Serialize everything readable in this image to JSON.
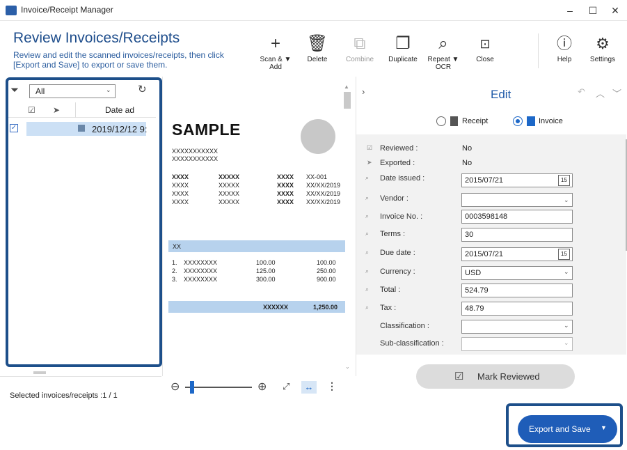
{
  "window": {
    "title": "Invoice/Receipt Manager",
    "minimize": "–",
    "maximize": "☐",
    "close": "✕"
  },
  "header": {
    "title": "Review Invoices/Receipts",
    "description": "Review and edit the scanned invoices/receipts, then click [Export and Save] to export or save them."
  },
  "toolbar": {
    "scan_add": "Scan & Add",
    "scan_add_l1": "Scan & ▼",
    "scan_add_l2": "Add",
    "delete": "Delete",
    "combine": "Combine",
    "duplicate": "Duplicate",
    "repeat_ocr_l1": "Repeat ▼",
    "repeat_ocr_l2": "OCR",
    "close": "Close",
    "help": "Help",
    "settings": "Settings"
  },
  "list": {
    "filter_value": "All",
    "column_date": "Date ad",
    "rows": [
      {
        "checked": true,
        "date": "2019/12/12 9:"
      }
    ],
    "status": "Selected invoices/receipts :1 / 1"
  },
  "preview": {
    "sample": "SAMPLE",
    "lines_top": [
      "XXXXXXXXXXX",
      "XXXXXXXXXXX"
    ],
    "grid_rows": [
      [
        "XXXX",
        "XXXXX",
        "XXXX",
        "XX-001"
      ],
      [
        "XXXX",
        "XXXXX",
        "XXXX",
        "XX/XX/2019"
      ],
      [
        "XXXX",
        "XXXXX",
        "XXXX",
        "XX/XX/2019"
      ],
      [
        "XXXX",
        "XXXXX",
        "XXXX",
        "XX/XX/2019"
      ]
    ],
    "section": "XX",
    "items": [
      [
        "1.",
        "XXXXXXXX",
        "100.00",
        "100.00"
      ],
      [
        "2.",
        "XXXXXXXX",
        "125.00",
        "250.00"
      ],
      [
        "3.",
        "XXXXXXXX",
        "300.00",
        "900.00"
      ]
    ],
    "total_label": "XXXXXX",
    "total_value": "1,250.00"
  },
  "edit": {
    "title": "Edit",
    "type_receipt": "Receipt",
    "type_invoice": "Invoice",
    "selected_type": "Invoice",
    "fields": {
      "reviewed": {
        "label": "Reviewed :",
        "value": "No"
      },
      "exported": {
        "label": "Exported :",
        "value": "No"
      },
      "date_issued": {
        "label": "Date issued :",
        "value": "2015/07/21"
      },
      "vendor": {
        "label": "Vendor :",
        "value": ""
      },
      "invoice_no": {
        "label": "Invoice No. :",
        "value": "0003598148"
      },
      "terms": {
        "label": "Terms :",
        "value": "30"
      },
      "due_date": {
        "label": "Due date :",
        "value": "2015/07/21"
      },
      "currency": {
        "label": "Currency :",
        "value": "USD"
      },
      "total": {
        "label": "Total :",
        "value": "524.79"
      },
      "tax": {
        "label": "Tax :",
        "value": "48.79"
      },
      "classification": {
        "label": "Classification :",
        "value": ""
      },
      "sub_classification": {
        "label": "Sub-classification :",
        "value": ""
      }
    },
    "calendar_day": "15",
    "mark_reviewed": "Mark Reviewed"
  },
  "footer": {
    "export_save": "Export and Save",
    "export_caret": "▼"
  },
  "colors": {
    "accent": "#1f5db8",
    "highlight_border": "#1d4f8a",
    "selected_row": "#cce0f5"
  }
}
